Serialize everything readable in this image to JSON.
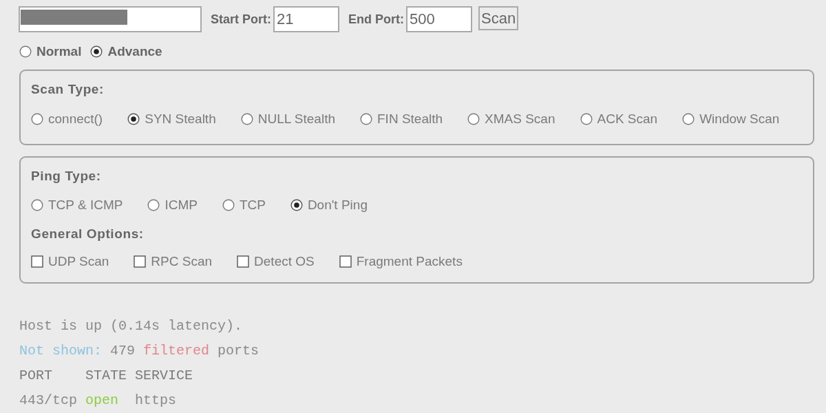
{
  "host_field": {
    "redacted": true
  },
  "start_port": {
    "label": "Start Port:",
    "value": "21"
  },
  "end_port": {
    "label": "End Port:",
    "value": "500"
  },
  "scan_button": "Scan",
  "modes": [
    {
      "label": "Normal",
      "selected": false
    },
    {
      "label": "Advance",
      "selected": true
    }
  ],
  "scan_type": {
    "title": "Scan Type:",
    "options": [
      {
        "label": "connect()",
        "selected": false
      },
      {
        "label": "SYN Stealth",
        "selected": true
      },
      {
        "label": "NULL Stealth",
        "selected": false
      },
      {
        "label": "FIN Stealth",
        "selected": false
      },
      {
        "label": "XMAS Scan",
        "selected": false
      },
      {
        "label": "ACK Scan",
        "selected": false
      },
      {
        "label": "Window Scan",
        "selected": false
      }
    ]
  },
  "ping_type": {
    "title": "Ping Type:",
    "options": [
      {
        "label": "TCP & ICMP",
        "selected": false
      },
      {
        "label": "ICMP",
        "selected": false
      },
      {
        "label": "TCP",
        "selected": false
      },
      {
        "label": "Don't Ping",
        "selected": true
      }
    ]
  },
  "general_options": {
    "title": "General Options:",
    "options": [
      {
        "label": "UDP Scan",
        "checked": false
      },
      {
        "label": "RPC Scan",
        "checked": false
      },
      {
        "label": "Detect OS",
        "checked": false
      },
      {
        "label": "Fragment Packets",
        "checked": false
      }
    ]
  },
  "output": {
    "lines": [
      {
        "segments": [
          {
            "text": "Host is up (0.14s latency).",
            "color": "#8a8a8a"
          }
        ]
      },
      {
        "segments": [
          {
            "text": "Not shown:",
            "color": "#8ec3e0"
          },
          {
            "text": " 479 ",
            "color": "#8a8a8a"
          },
          {
            "text": "filtered",
            "color": "#e4868c"
          },
          {
            "text": " ports",
            "color": "#8a8a8a"
          }
        ]
      },
      {
        "segments": [
          {
            "text": "PORT    STATE SERVICE",
            "color": "#7a7a7a"
          }
        ]
      },
      {
        "segments": [
          {
            "text": "443/tcp ",
            "color": "#8a8a8a"
          },
          {
            "text": "open",
            "color": "#8fcb45"
          },
          {
            "text": "  https",
            "color": "#8a8a8a"
          }
        ]
      }
    ]
  }
}
